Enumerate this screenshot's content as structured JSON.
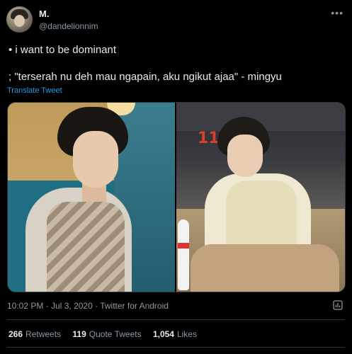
{
  "author": {
    "display_name": "M.",
    "handle": "@dandelionnim",
    "avatar_icon": "user-avatar"
  },
  "more_icon": "more-options-icon",
  "tweet": {
    "line1": "• i want to be dominant",
    "line2": "; \"terserah nu deh mau ngapain, aku ngikut ajaa\" - mingyu",
    "translate_label": "Translate Tweet"
  },
  "media": {
    "right_photo_sign": "11"
  },
  "meta": {
    "time": "10:02 PM",
    "sep1": " · ",
    "date": "Jul 3, 2020",
    "sep2": " · ",
    "source": "Twitter for Android"
  },
  "stats": {
    "retweets_count": "266",
    "retweets_label": "Retweets",
    "quotes_count": "119",
    "quotes_label": "Quote Tweets",
    "likes_count": "1,054",
    "likes_label": "Likes"
  },
  "colors": {
    "background": "#000000",
    "text_primary": "#e7e9ea",
    "text_secondary": "#8b98a5",
    "link": "#1d9bf0",
    "border": "#2f3336"
  }
}
